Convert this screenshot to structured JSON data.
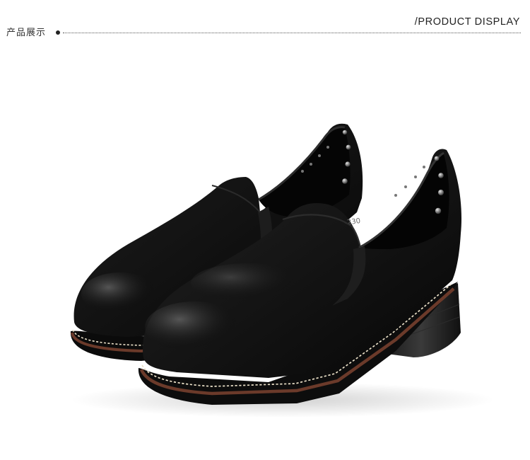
{
  "header": {
    "title_cn": "产品展示",
    "title_en": "/PRODUCT DISPLAY"
  },
  "product": {
    "image_description": "",
    "visible_imprint": "-230"
  },
  "colors": {
    "background": "#ffffff",
    "leather": "#111111",
    "welt": "#6b3a2a",
    "stitch": "#e9dfc7",
    "stud": "#9a9a9a"
  }
}
